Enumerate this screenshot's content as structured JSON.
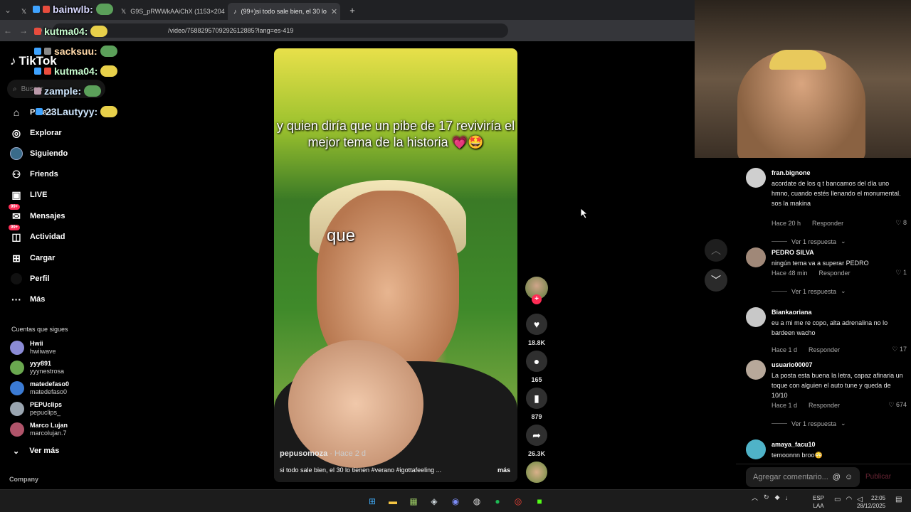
{
  "browser": {
    "tabs": [
      {
        "label": "",
        "active": false
      },
      {
        "label": "G9S_pRWWkAAiChX (1153×204",
        "active": false
      },
      {
        "label": "(99+)si todo sale bien, el 30 lo",
        "active": true
      }
    ],
    "new_tab": "+",
    "url": "/video/7588295709292612885?lang=es-419"
  },
  "sidebar": {
    "logo": "TikTok",
    "search_placeholder": "Buscar",
    "nav": [
      {
        "label": "Para ti",
        "icon": "home-icon",
        "glyph": "⌂"
      },
      {
        "label": "Explorar",
        "icon": "compass-icon",
        "glyph": "◎"
      },
      {
        "label": "Siguiendo",
        "icon": "following-icon",
        "glyph": "●"
      },
      {
        "label": "Friends",
        "icon": "friends-icon",
        "glyph": "⚇"
      },
      {
        "label": "LIVE",
        "icon": "live-icon",
        "glyph": "▣"
      },
      {
        "label": "Mensajes",
        "icon": "messages-icon",
        "glyph": "✉",
        "badge": "99+"
      },
      {
        "label": "Actividad",
        "icon": "activity-icon",
        "glyph": "◫",
        "badge": "99+"
      },
      {
        "label": "Cargar",
        "icon": "upload-icon",
        "glyph": "⊞"
      },
      {
        "label": "Perfil",
        "icon": "profile-icon",
        "glyph": "●"
      },
      {
        "label": "Más",
        "icon": "more-icon",
        "glyph": "···"
      }
    ],
    "following_title": "Cuentas que sigues",
    "following": [
      {
        "name": "Hwii",
        "handle": "hwiiwave",
        "color": "#8b8bd6"
      },
      {
        "name": "yyy891",
        "handle": "yyynestrosa",
        "color": "#6aa84f"
      },
      {
        "name": "matedefaso0",
        "handle": "matedefaso0",
        "color": "#3b7bd4"
      },
      {
        "name": "PEPUclips",
        "handle": "pepuclips_",
        "color": "#9aa5b0"
      },
      {
        "name": "Marco Lujan",
        "handle": "marcolujan.7",
        "color": "#b0546a"
      }
    ],
    "see_more": "Ver más",
    "company": "Company"
  },
  "chat_overlay": [
    {
      "user": "bainwlb:"
    },
    {
      "user": "kutma04:"
    },
    {
      "user": "sacksuu:"
    },
    {
      "user": "kutma04:"
    },
    {
      "user": "zample:"
    },
    {
      "user": "23Lautyyy:"
    }
  ],
  "video": {
    "caption": "y quien diría que un pibe de 17 reviviría el mejor tema de la historia 💗🤩",
    "subtitle": "que",
    "author": "pepusomoza",
    "time": "· Hace 2 d",
    "description": "si todo sale bien, el 30 lo tienen #verano #igottafeeling ...",
    "more": "más",
    "actions": {
      "likes": "18.8K",
      "comments": "165",
      "saves": "879",
      "shares": "26.3K"
    }
  },
  "comments": [
    {
      "user": "fran.bignone",
      "text": "acordate de los q t bancamos del día uno hmno, cuando estés llenando el monumental. sos la makina",
      "time": "Hace 20 h",
      "reply": "Responder",
      "likes": "8",
      "replies": "Ver 1 respuesta",
      "color": "#cfcfcf"
    },
    {
      "user": "PEDRO SILVA",
      "text": "ningún tema va a superar PEDRO",
      "time": "Hace 48 min",
      "reply": "Responder",
      "likes": "1",
      "replies": "Ver 1 respuesta",
      "color": "#a08878"
    },
    {
      "user": "Biankaoriana",
      "text": "eu a mi me re copo, alta adrenalina no lo bardeen wacho",
      "time": "Hace 1 d",
      "reply": "Responder",
      "likes": "17",
      "replies": "",
      "color": "#c8c8c8"
    },
    {
      "user": "usuario00007",
      "text": "La posta esta buena la letra, capaz afinaria un toque con alguien el auto tune y queda de 10/10",
      "time": "Hace 1 d",
      "reply": "Responder",
      "likes": "674",
      "replies": "Ver 1 respuesta",
      "color": "#b7a89a"
    },
    {
      "user": "amaya_facu10",
      "text": "temoonnn broo😳",
      "time": "",
      "reply": "",
      "likes": "",
      "replies": "",
      "color": "#4fb3c8"
    }
  ],
  "comment_box": {
    "placeholder": "Agregar comentario...",
    "post": "Publicar"
  },
  "taskbar": {
    "lang_line1": "ESP",
    "lang_line2": "LAA",
    "time": "22:05",
    "date": "28/12/2025"
  }
}
